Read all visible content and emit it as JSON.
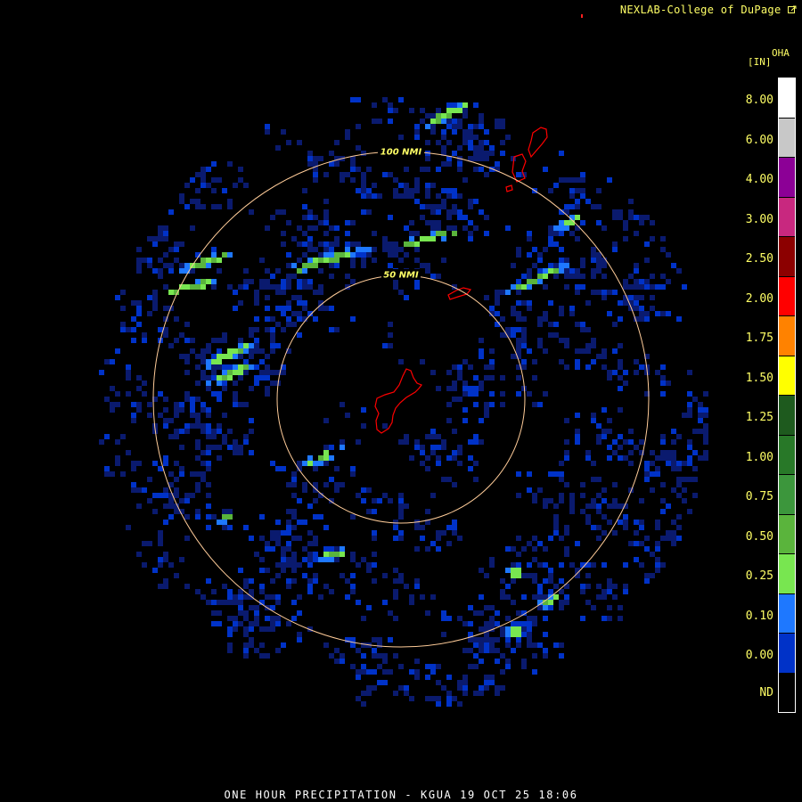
{
  "credit": "NEXLAB-College of DuPage",
  "credit_icon": "external-link-icon",
  "product_code": "OHA",
  "units": "[IN]",
  "caption": "ONE HOUR PRECIPITATION - KGUA 19 OCT 25 18:06",
  "range_rings": [
    {
      "label": "100 NMI",
      "distance_nmi": 100
    },
    {
      "label": "50 NMI",
      "distance_nmi": 50
    }
  ],
  "colors": {
    "ring": "#ffcc99",
    "coastline": "#ff0000",
    "label": "#ffff66"
  },
  "legend": [
    {
      "label": "8.00",
      "color": "#ffffff"
    },
    {
      "label": "6.00",
      "color": "#c8c8c8"
    },
    {
      "label": "4.00",
      "color": "#8c0096"
    },
    {
      "label": "3.00",
      "color": "#c8287f"
    },
    {
      "label": "2.50",
      "color": "#8c0000"
    },
    {
      "label": "2.00",
      "color": "#ff0000"
    },
    {
      "label": "1.75",
      "color": "#ff8200"
    },
    {
      "label": "1.50",
      "color": "#ffff00"
    },
    {
      "label": "1.25",
      "color": "#1e5a1e"
    },
    {
      "label": "1.00",
      "color": "#287828"
    },
    {
      "label": "0.75",
      "color": "#3c963c"
    },
    {
      "label": "0.50",
      "color": "#5ab43c"
    },
    {
      "label": "0.25",
      "color": "#78e650"
    },
    {
      "label": "0.10",
      "color": "#1e78ff"
    },
    {
      "label": "0.00",
      "color": "#0032c8"
    },
    {
      "label": "ND",
      "color": "#000000"
    }
  ]
}
